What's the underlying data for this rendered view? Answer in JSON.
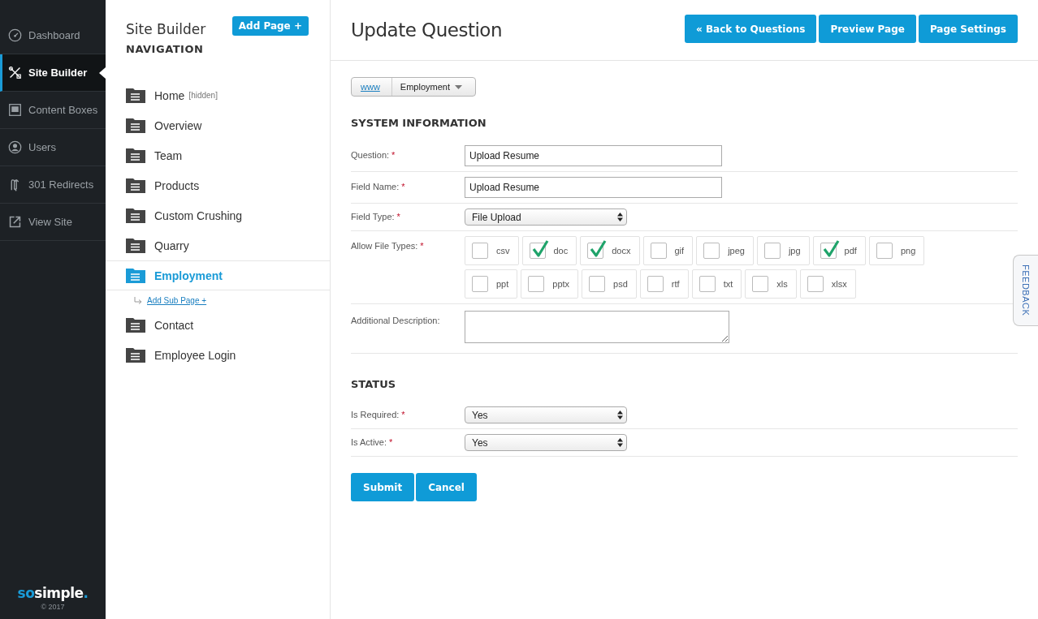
{
  "sidebar": {
    "items": [
      {
        "label": "Dashboard",
        "selected": false
      },
      {
        "label": "Site Builder",
        "selected": true
      },
      {
        "label": "Content Boxes",
        "selected": false
      },
      {
        "label": "Users",
        "selected": false
      },
      {
        "label": "301 Redirects",
        "selected": false
      },
      {
        "label": "View Site",
        "selected": false
      }
    ],
    "logo": {
      "prefix": "so",
      "name": "simple",
      "suffix": "."
    },
    "copyright": "© 2017"
  },
  "nav_panel": {
    "title": "Site Builder",
    "add_button": "Add Page +",
    "heading": "NAVIGATION",
    "pages": [
      {
        "label": "Home",
        "note": "[hidden]",
        "selected": false
      },
      {
        "label": "Overview",
        "selected": false
      },
      {
        "label": "Team",
        "selected": false
      },
      {
        "label": "Products",
        "selected": false
      },
      {
        "label": "Custom Crushing",
        "selected": false
      },
      {
        "label": "Quarry",
        "selected": false
      },
      {
        "label": "Employment",
        "selected": true,
        "add_sub_page": "Add Sub Page +"
      },
      {
        "label": "Contact",
        "selected": false
      },
      {
        "label": "Employee Login",
        "selected": false
      }
    ]
  },
  "main": {
    "title": "Update Question",
    "buttons": [
      "« Back to Questions",
      "Preview Page",
      "Page Settings"
    ],
    "breadcrumb": {
      "root": "www",
      "current": "Employment"
    },
    "sections": [
      {
        "heading": "SYSTEM INFORMATION",
        "fields": [
          {
            "kind": "text",
            "label": "Question:",
            "required_mark": "*",
            "value": "Upload Resume"
          },
          {
            "kind": "text",
            "label": "Field Name:",
            "required_mark": "*",
            "value": "Upload Resume"
          },
          {
            "kind": "select",
            "label": "Field Type:",
            "required_mark": "*",
            "value": "File Upload"
          },
          {
            "kind": "checkboxes",
            "label": "Allow File Types:",
            "required_mark": "*",
            "options": [
              {
                "label": "csv",
                "checked": false
              },
              {
                "label": "doc",
                "checked": true
              },
              {
                "label": "docx",
                "checked": true
              },
              {
                "label": "gif",
                "checked": false
              },
              {
                "label": "jpeg",
                "checked": false
              },
              {
                "label": "jpg",
                "checked": false
              },
              {
                "label": "pdf",
                "checked": true
              },
              {
                "label": "png",
                "checked": false
              },
              {
                "label": "ppt",
                "checked": false
              },
              {
                "label": "pptx",
                "checked": false
              },
              {
                "label": "psd",
                "checked": false
              },
              {
                "label": "rtf",
                "checked": false
              },
              {
                "label": "txt",
                "checked": false
              },
              {
                "label": "xls",
                "checked": false
              },
              {
                "label": "xlsx",
                "checked": false
              }
            ]
          },
          {
            "kind": "textarea",
            "label": "Additional Description:"
          }
        ]
      },
      {
        "heading": "STATUS",
        "fields": [
          {
            "kind": "select",
            "label": "Is Required:",
            "required_mark": "*",
            "value": "Yes"
          },
          {
            "kind": "select",
            "label": "Is Active:",
            "required_mark": "*",
            "value": "Yes"
          }
        ]
      }
    ],
    "actions": [
      "Submit",
      "Cancel"
    ],
    "feedback": "FEEDBACK"
  }
}
